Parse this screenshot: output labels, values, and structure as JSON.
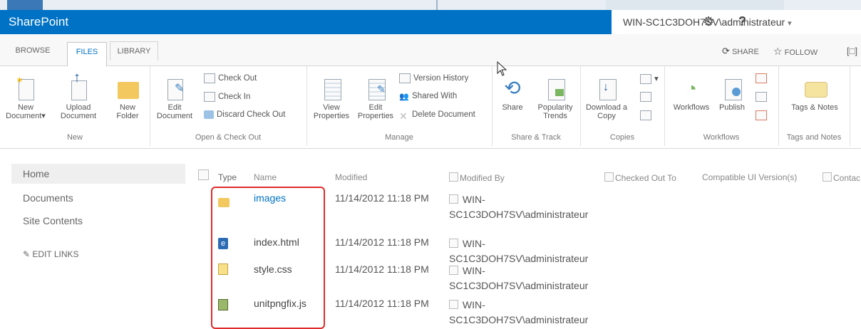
{
  "suite": {
    "brand": "SharePoint",
    "user": "WIN-SC1C3DOH7SV\\administrateur",
    "user_caret": "▾",
    "gear_icon": "gear-icon",
    "help": "?"
  },
  "tabs": [
    {
      "label": "BROWSE",
      "active": false
    },
    {
      "label": "FILES",
      "active": true
    },
    {
      "label": "LIBRARY",
      "active": false
    }
  ],
  "social": {
    "share": "SHARE",
    "follow": "FOLLOW"
  },
  "ribbon": {
    "new": {
      "label": "New",
      "new_document": "New Document",
      "upload_document": "Upload Document",
      "new_folder": "New Folder"
    },
    "open": {
      "label": "Open & Check Out",
      "edit_document": "Edit Document",
      "check_out": "Check Out",
      "check_in": "Check In",
      "discard": "Discard Check Out"
    },
    "manage": {
      "label": "Manage",
      "view_properties": "View Properties",
      "edit_properties": "Edit Properties",
      "version_history": "Version History",
      "shared_with": "Shared With",
      "delete_document": "Delete Document"
    },
    "share_track": {
      "label": "Share & Track",
      "share": "Share",
      "popularity_trends": "Popularity Trends"
    },
    "copies": {
      "label": "Copies",
      "download_copy": "Download a Copy"
    },
    "workflows": {
      "label": "Workflows",
      "workflows": "Workflows",
      "publish": "Publish"
    },
    "tags": {
      "label": "Tags and Notes",
      "tags_notes": "Tags & Notes"
    }
  },
  "nav": {
    "items": [
      "Home",
      "Documents",
      "Site Contents"
    ],
    "edit_links": "EDIT LINKS"
  },
  "columns": {
    "type": "Type",
    "name": "Name",
    "modified": "Modified",
    "modified_by": "Modified By",
    "checked_out_to": "Checked Out To",
    "compatible": "Compatible UI Version(s)",
    "contact": "Contac"
  },
  "rows": [
    {
      "icon": "folder-icon",
      "name": "images",
      "modified": "11/14/2012 11:18 PM",
      "by1": "WIN-",
      "by2": "SC1C3DOH7SV\\administrateur"
    },
    {
      "icon": "html-file-icon",
      "name": "index.html",
      "modified": "11/14/2012 11:18 PM",
      "by1": "WIN-",
      "by2": "SC1C3DOH7SV\\administrateur"
    },
    {
      "icon": "css-file-icon",
      "name": "style.css",
      "modified": "11/14/2012 11:18 PM",
      "by1": "WIN-",
      "by2": "SC1C3DOH7SV\\administrateur"
    },
    {
      "icon": "js-file-icon",
      "name": "unitpngfix.js",
      "modified": "11/14/2012 11:18 PM",
      "by1": "WIN-",
      "by2": "SC1C3DOH7SV\\administrateur"
    }
  ],
  "colors": {
    "accent": "#0072c6",
    "highlight": "#e02b2b"
  }
}
